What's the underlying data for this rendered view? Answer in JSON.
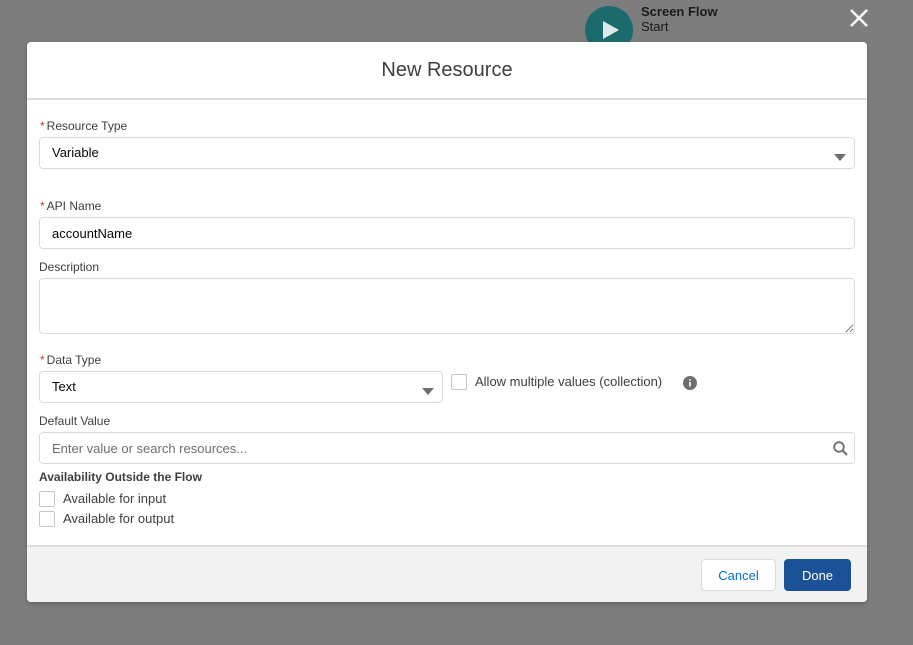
{
  "background": {
    "node_title": "Screen Flow",
    "node_subtitle": "Start",
    "close_icon": "close-icon"
  },
  "modal": {
    "title": "New Resource",
    "resource_type": {
      "label": "Resource Type",
      "required": true,
      "value": "Variable"
    },
    "api_name": {
      "label": "API Name",
      "required": true,
      "value": "accountName"
    },
    "description": {
      "label": "Description",
      "value": ""
    },
    "data_type": {
      "label": "Data Type",
      "required": true,
      "value": "Text"
    },
    "allow_multiple": {
      "label": "Allow multiple values (collection)",
      "checked": false
    },
    "default_value": {
      "label": "Default Value",
      "placeholder": "Enter value or search resources..."
    },
    "availability": {
      "title": "Availability Outside the Flow",
      "input_label": "Available for input",
      "output_label": "Available for output"
    }
  },
  "footer": {
    "cancel_label": "Cancel",
    "done_label": "Done"
  },
  "colors": {
    "primary_button": "#1b5297",
    "link": "#0070d2",
    "required": "#c23934",
    "overlay": "#7d7d7d",
    "node": "#1b6b6d"
  }
}
